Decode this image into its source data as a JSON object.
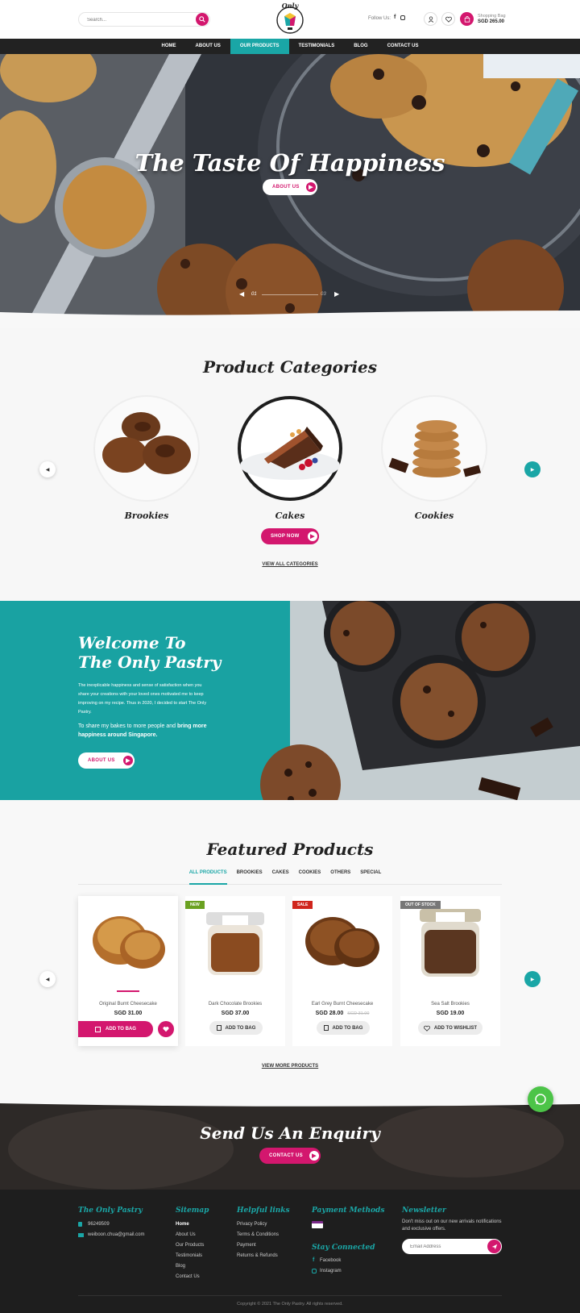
{
  "header": {
    "search_placeholder": "Search...",
    "logo_text": "Only",
    "follow_label": "Follow Us:",
    "bag_label": "Shopping Bag",
    "bag_total": "SGD 265.00"
  },
  "nav": {
    "items": [
      "HOME",
      "ABOUT US",
      "OUR PRODUCTS",
      "TESTIMONIALS",
      "BLOG",
      "CONTACT US"
    ]
  },
  "hero": {
    "title": "The Taste Of Happiness",
    "button": "ABOUT US",
    "slide_current": "01",
    "slide_total": "03"
  },
  "categories": {
    "title": "Product Categories",
    "items": [
      "Brookies",
      "Cakes",
      "Cookies"
    ],
    "shop_button": "SHOP NOW",
    "view_all": "VIEW ALL CATEGORIES"
  },
  "welcome": {
    "title_line1": "Welcome To",
    "title_line2": "The Only Pastry",
    "paragraph": "The inexplicable happiness and sense of satisfaction when you share your creations with your loved ones motivated me to keep improving on my recipe. Thus in 2020, I decided to start The Only Pastry.",
    "lead": "To share my bakes to more people and",
    "lead_bold": "bring more happiness around Singapore.",
    "button": "ABOUT US"
  },
  "featured": {
    "title": "Featured Products",
    "tabs": [
      "ALL PRODUCTS",
      "BROOKIES",
      "CAKES",
      "COOKIES",
      "OTHERS",
      "SPECIAL"
    ],
    "products": [
      {
        "name": "Original Burnt Cheesecake",
        "price": "SGD 31.00",
        "old_price": "",
        "badge": "",
        "action": "ADD TO BAG"
      },
      {
        "name": "Dark Chocolate Brookies",
        "price": "SGD 37.00",
        "old_price": "",
        "badge": "NEW",
        "action": "ADD TO BAG"
      },
      {
        "name": "Earl Grey Burnt Cheesecake",
        "price": "SGD 28.00",
        "old_price": "SGD 31.00",
        "badge": "SALE",
        "action": "ADD TO BAG"
      },
      {
        "name": "Sea Salt Brookies",
        "price": "SGD 19.00",
        "old_price": "",
        "badge": "OUT OF STOCK",
        "action": "ADD TO WISHLIST"
      }
    ],
    "view_more": "VIEW MORE PRODUCTS"
  },
  "enquiry": {
    "title": "Send Us An Enquiry",
    "button": "CONTACT US"
  },
  "footer": {
    "brand": "The Only Pastry",
    "phone": "96249509",
    "email": "weiboon.chua@gmail.com",
    "sitemap_title": "Sitemap",
    "sitemap": [
      "Home",
      "About Us",
      "Our Products",
      "Testimonials",
      "Blog",
      "Contact Us"
    ],
    "helpful_title": "Helpful links",
    "helpful": [
      "Privacy Policy",
      "Terms & Conditions",
      "Payment",
      "Returns & Refunds"
    ],
    "payment_title": "Payment Methods",
    "stay_title": "Stay Connected",
    "social": [
      "Facebook",
      "Instagram"
    ],
    "newsletter_title": "Newsletter",
    "newsletter_text": "Don't miss out on our new arrivals notifications and exclusive offers.",
    "email_placeholder": "Email Address",
    "copyright": "Copyright © 2021 The Only Pastry. All rights reserved."
  },
  "colors": {
    "accent": "#1aa6a6",
    "brand": "#d3176e",
    "dark": "#222222"
  }
}
